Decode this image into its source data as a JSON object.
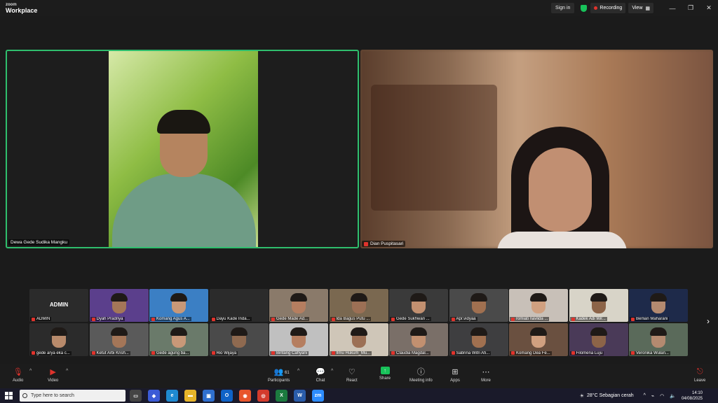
{
  "titlebar": {
    "logo_line1": "zoom",
    "logo_line2": "Workplace",
    "sign_in": "Sign in",
    "recording": "Recording",
    "view": "View"
  },
  "main_speakers": [
    {
      "name": "Dewa Gede Sudika Mangku"
    },
    {
      "name": "Dian Puspitasari"
    }
  ],
  "gallery": {
    "admin_label": "ADMIN",
    "row1": [
      "ADMIN",
      "Dyah Pradnya",
      "Komang Agus A...",
      "Dayu Kade Inda...",
      "Gede Made Ad...",
      "Ida Bagus Putu ...",
      "Gede Sukhwan ...",
      "Apr.vidyaa",
      "romiati navlida ...",
      "Kadek Adi Wir...",
      "Berlian Maharani"
    ],
    "row2": [
      "gede arya eka c...",
      "Ketut Arbi Krish...",
      "Gede agung ba...",
      "Rio Wijaya",
      "Bintang Cahyani",
      "Ilmu Hukum_Mu...",
      "Claudia Magdal...",
      "Sabrina Witri Afi...",
      "Komang Dea Fe...",
      "Filomena Luju",
      "Veronika Wulan..."
    ]
  },
  "controls": {
    "audio": "Audio",
    "video": "Video",
    "participants": "Participants",
    "participants_count": "61",
    "chat": "Chat",
    "react": "React",
    "share": "Share",
    "meeting_info": "Meeting info",
    "apps": "Apps",
    "more": "More",
    "leave": "Leave"
  },
  "taskbar": {
    "search_placeholder": "Type here to search",
    "weather": "28°C  Sebagian cerah",
    "time": "14:10",
    "date": "04/08/2025"
  },
  "colors": {
    "active_speaker_border": "#2fbe6d",
    "recording_dot": "#e0332c",
    "share_green": "#18c25a"
  }
}
